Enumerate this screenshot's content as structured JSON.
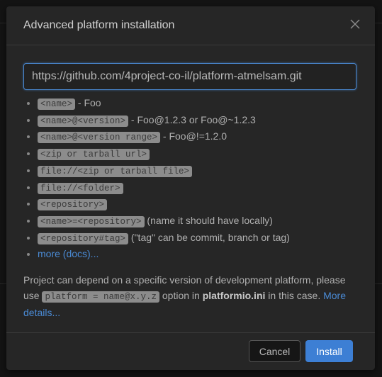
{
  "dialog": {
    "title": "Advanced platform installation",
    "input_value": "https://github.com/4project-co-il/platform-atmelsam.git",
    "items": [
      {
        "code": "<name>",
        "text": " - Foo"
      },
      {
        "code": "<name>@<version>",
        "text": " - Foo@1.2.3 or Foo@~1.2.3"
      },
      {
        "code": "<name>@<version range>",
        "text": " - Foo@!=1.2.0"
      },
      {
        "code": "<zip or tarball url>",
        "text": ""
      },
      {
        "code": "file://<zip or tarball file>",
        "text": ""
      },
      {
        "code": "file://<folder>",
        "text": ""
      },
      {
        "code": "<repository>",
        "text": ""
      },
      {
        "code": "<name>=<repository>",
        "text": " (name it should have locally)"
      },
      {
        "code": "<repository#tag>",
        "text": " (\"tag\" can be commit, branch or tag)"
      }
    ],
    "more_docs": "more (docs)...",
    "note_pre": "Project can depend on a specific version of development platform, please use ",
    "note_code": "platform = name@x.y.z",
    "note_mid": " option in ",
    "note_file": "platformio.ini",
    "note_post": " in this case. ",
    "note_link": "More details...",
    "cancel": "Cancel",
    "install": "Install"
  }
}
